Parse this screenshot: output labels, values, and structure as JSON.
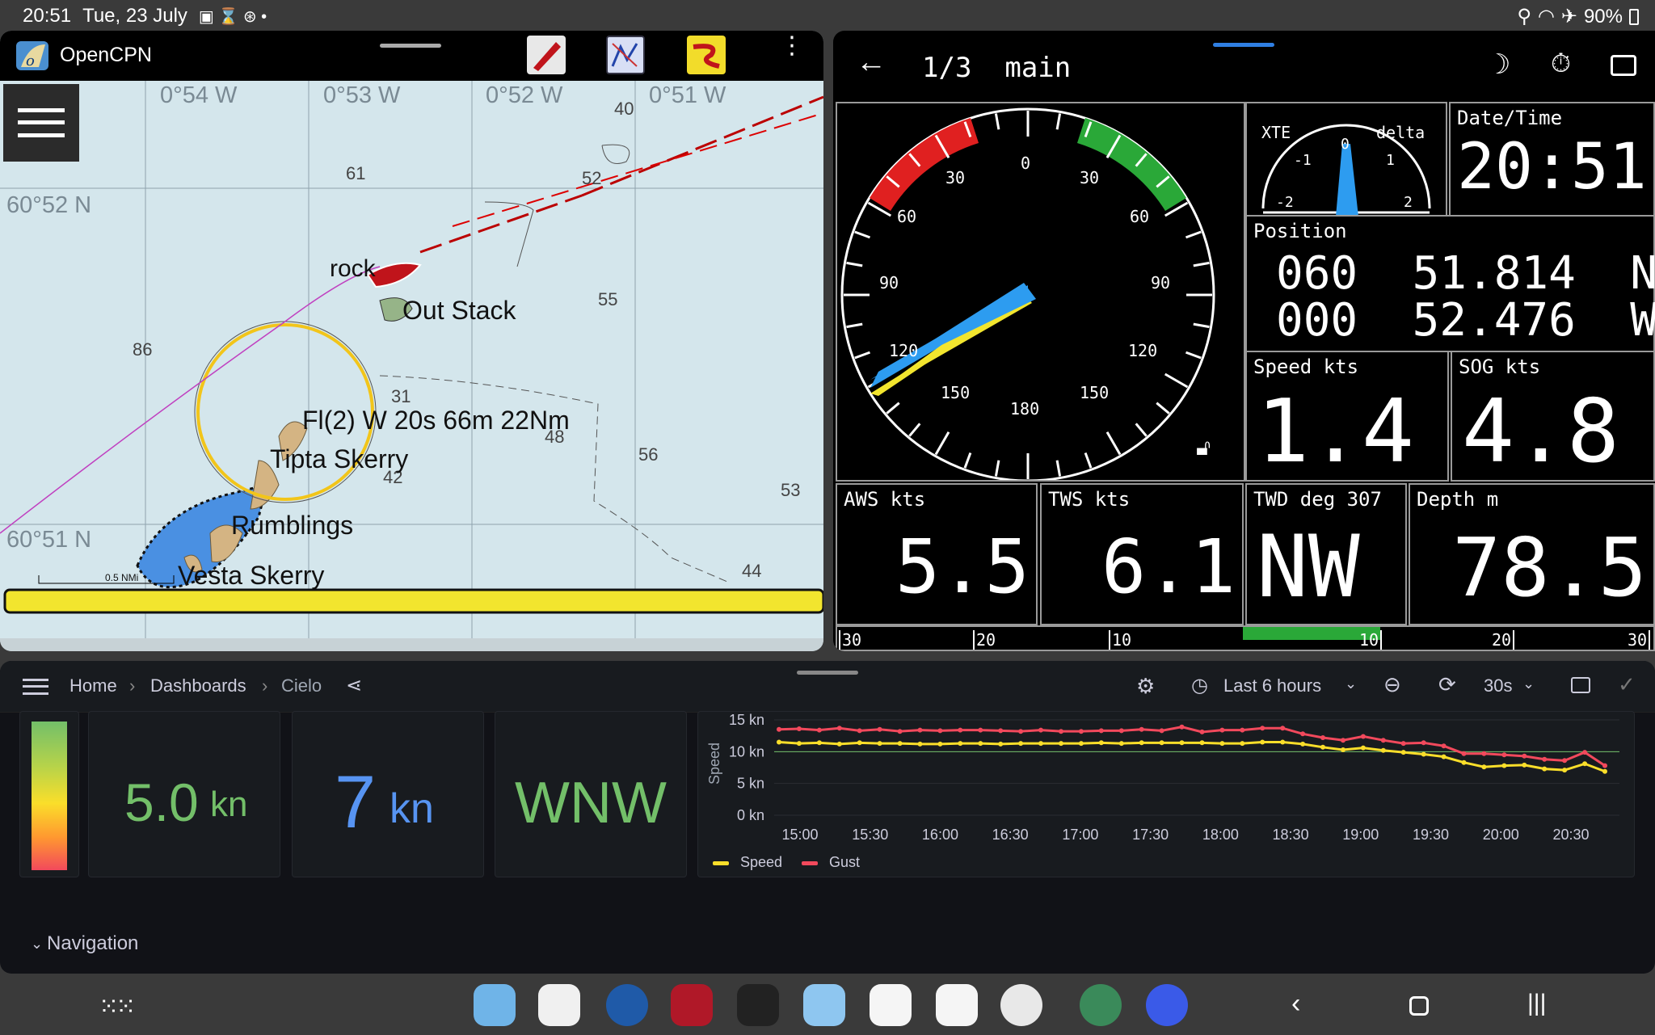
{
  "statusbar": {
    "time": "20:51",
    "date": "Tue, 23 July",
    "battery": "90%"
  },
  "opencpn": {
    "title": "OpenCPN",
    "lon_labels": [
      "0°54 W",
      "0°53 W",
      "0°52 W",
      "0°51 W"
    ],
    "lat_labels": [
      "60°52 N",
      "60°51 N"
    ],
    "depths": [
      "40",
      "61",
      "52",
      "55",
      "86",
      "31",
      "48",
      "56",
      "42",
      "53",
      "44"
    ],
    "places": {
      "rock": "rock",
      "out_stack": "Out Stack",
      "light": "Fl(2) W 20s 66m 22Nm",
      "tipta": "Tipta Skerry",
      "rumblings": "Rumblings",
      "vesta": "Vesta Skerry"
    },
    "scale": "0.5 NMi"
  },
  "dashboard": {
    "page": "1/3  main",
    "wind_ticks": [
      "0",
      "30",
      "30",
      "60",
      "60",
      "90",
      "90",
      "120",
      "120",
      "150",
      "150",
      "180"
    ],
    "xte": {
      "label": "XTE",
      "delta": "delta",
      "ticks": [
        "-2",
        "-1",
        "0",
        "1",
        "2"
      ]
    },
    "datetime": {
      "label": "Date/Time",
      "value": "20:51"
    },
    "position": {
      "label": "Position",
      "lat": "060  51.814  N",
      "lon": "000  52.476  W"
    },
    "speed": {
      "label": "Speed kts",
      "value": "1.4"
    },
    "sog": {
      "label": "SOG kts",
      "value": "4.8"
    },
    "aws": {
      "label": "AWS kts",
      "value": "5.5"
    },
    "tws": {
      "label": "TWS kts",
      "value": "6.1"
    },
    "twd": {
      "label": "TWD deg 307",
      "value": "NW"
    },
    "depth": {
      "label": "Depth m",
      "value": "78.5"
    },
    "bar_ticks": [
      "30",
      "20",
      "10",
      "10",
      "20",
      "30"
    ]
  },
  "grafana": {
    "breadcrumb": [
      "Home",
      "Dashboards",
      "Cielo"
    ],
    "time_range": "Last 6 hours",
    "refresh": "30s",
    "sog": {
      "value": "5.0",
      "unit": "kn"
    },
    "wind_speed": {
      "value": "7",
      "unit": "kn"
    },
    "direction": {
      "value": "WNW"
    },
    "section": "Navigation",
    "colors": {
      "green": "#73bf69",
      "blue": "#5794f2",
      "yellow": "#fade2a",
      "red": "#f2495c"
    },
    "chart_data": {
      "type": "line",
      "ylabel": "Speed",
      "y_ticks": [
        "0 kn",
        "5 kn",
        "10 kn",
        "15 kn"
      ],
      "ylim": [
        0,
        15
      ],
      "threshold": 10,
      "categories": [
        "15:00",
        "15:30",
        "16:00",
        "16:30",
        "17:00",
        "17:30",
        "18:00",
        "18:30",
        "19:00",
        "19:30",
        "20:00",
        "20:30"
      ],
      "series": [
        {
          "name": "Speed",
          "color": "#fade2a",
          "values": [
            11.5,
            11.3,
            11.4,
            11.2,
            11.4,
            11.3,
            11.3,
            11.2,
            11.2,
            11.3,
            11.3,
            11.2,
            11.3,
            11.3,
            11.3,
            11.3,
            11.4,
            11.3,
            11.4,
            11.4,
            11.4,
            11.4,
            11.3,
            11.3,
            11.5,
            11.5,
            11.2,
            10.7,
            10.3,
            10.6,
            10.2,
            9.9,
            9.6,
            9.2,
            8.3,
            7.6,
            7.8,
            7.9,
            7.3,
            7.1,
            8.1,
            6.9
          ]
        },
        {
          "name": "Gust",
          "color": "#f2495c",
          "values": [
            13.5,
            13.6,
            13.4,
            13.7,
            13.3,
            13.5,
            13.2,
            13.4,
            13.3,
            13.4,
            13.4,
            13.3,
            13.2,
            13.4,
            13.2,
            13.2,
            13.3,
            13.3,
            13.5,
            13.3,
            13.9,
            13.1,
            13.4,
            13.4,
            13.7,
            13.7,
            12.8,
            12.2,
            11.8,
            12.4,
            11.8,
            11.3,
            11.4,
            10.9,
            9.7,
            9.7,
            9.5,
            9.3,
            8.8,
            8.6,
            9.9,
            7.8
          ]
        }
      ]
    }
  }
}
